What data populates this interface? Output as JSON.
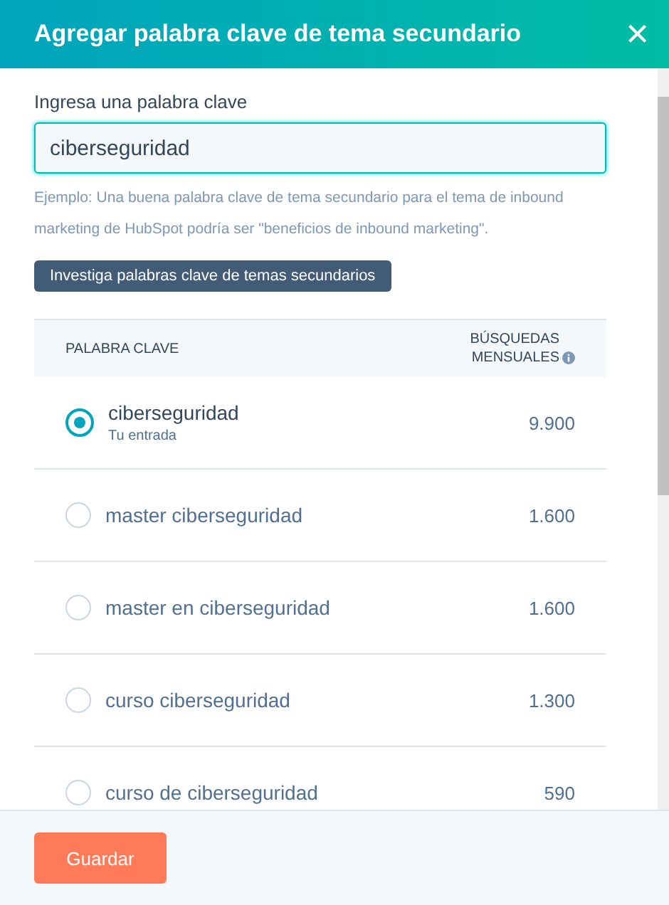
{
  "dialog": {
    "title": "Agregar palabra clave de tema secundario",
    "close": "×"
  },
  "keyword_field": {
    "label": "Ingresa una palabra clave",
    "value": "ciberseguridad",
    "hint": "Ejemplo: Una buena palabra clave de tema secundario para el tema de inbound marketing de HubSpot podría ser \"beneficios de inbound marketing\"."
  },
  "research_button": "Investiga palabras clave de temas secundarios",
  "table": {
    "columns": [
      "PALABRA CLAVE",
      "BÚSQUEDAS MENSUALES"
    ],
    "rows": [
      {
        "keyword": "ciberseguridad",
        "note": "Tu entrada",
        "searches": "9.900",
        "selected": true
      },
      {
        "keyword": "master ciberseguridad",
        "searches": "1.600",
        "selected": false
      },
      {
        "keyword": "master en ciberseguridad",
        "searches": "1.600",
        "selected": false
      },
      {
        "keyword": "curso ciberseguridad",
        "searches": "1.300",
        "selected": false
      },
      {
        "keyword": "curso de ciberseguridad",
        "searches": "590",
        "selected": false
      }
    ]
  },
  "footer": {
    "save_button": "Guardar"
  }
}
